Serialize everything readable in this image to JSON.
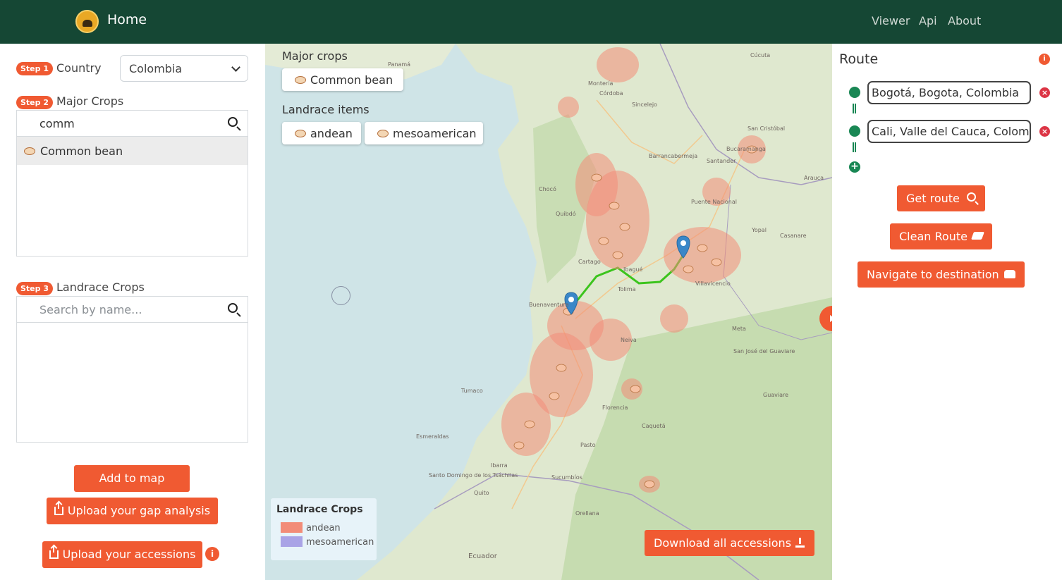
{
  "header": {
    "title": "Home",
    "nav": [
      "Viewer",
      "Api",
      "About"
    ]
  },
  "left": {
    "step1": {
      "badge": "Step 1",
      "label": "Country",
      "value": "Colombia"
    },
    "step2": {
      "badge": "Step 2",
      "label": "Major Crops",
      "search_value": "comm",
      "results": [
        "Common bean"
      ]
    },
    "step3": {
      "badge": "Step 3",
      "label": "Landrace Crops",
      "search_placeholder": "Search by name..."
    },
    "add_button": "Add to map",
    "upload_gap_button": "Upload your gap analysis",
    "upload_accessions_button": "Upload your accessions",
    "info_glyph": "i"
  },
  "map": {
    "major_crops_title": "Major crops",
    "major_crops": [
      "Common bean"
    ],
    "landrace_title": "Landrace items",
    "landrace_items": [
      "andean",
      "mesoamerican"
    ],
    "legend": {
      "title": "Landrace Crops",
      "items": [
        {
          "label": "andean",
          "color": "#f28c78"
        },
        {
          "label": "mesoamerican",
          "color": "#a9a3e6"
        }
      ]
    },
    "download_button": "Download all accessions",
    "place_labels": [
      "Panamá",
      "Montería",
      "Cartago",
      "Buenaventura",
      "Quibdó",
      "Bucaramanga",
      "Cúcuta",
      "Puente Nacional",
      "Yopal",
      "Florencia",
      "Pasto",
      "Ecuador",
      "Quito",
      "Tumaco",
      "Meta",
      "Guaviare",
      "Caquetá",
      "Esmeraldas",
      "Santo Domingo de los Tsáchilas",
      "Ibarra",
      "Sucumbíos",
      "Orellana",
      "San José del Guaviare",
      "Arauca",
      "Casanare",
      "Neiva",
      "Villavicencio",
      "Tolima",
      "Ibagué",
      "Chocó",
      "Santander",
      "San Cristóbal",
      "Barrancabermeja",
      "Sincelejo",
      "Córdoba"
    ]
  },
  "route": {
    "title": "Route",
    "origin": "Bogotá, Bogota, Colombia",
    "destination": "Cali, Valle del Cauca, Colombia",
    "get_route": "Get route",
    "clean_route": "Clean Route",
    "navigate": "Navigate to destination",
    "remove_glyph": "×",
    "add_glyph": "+",
    "info_glyph": "i"
  },
  "colors": {
    "header_bg": "#154734",
    "accent": "#f05a32",
    "route_green": "#198754",
    "marker_blue": "#3a87c8"
  }
}
